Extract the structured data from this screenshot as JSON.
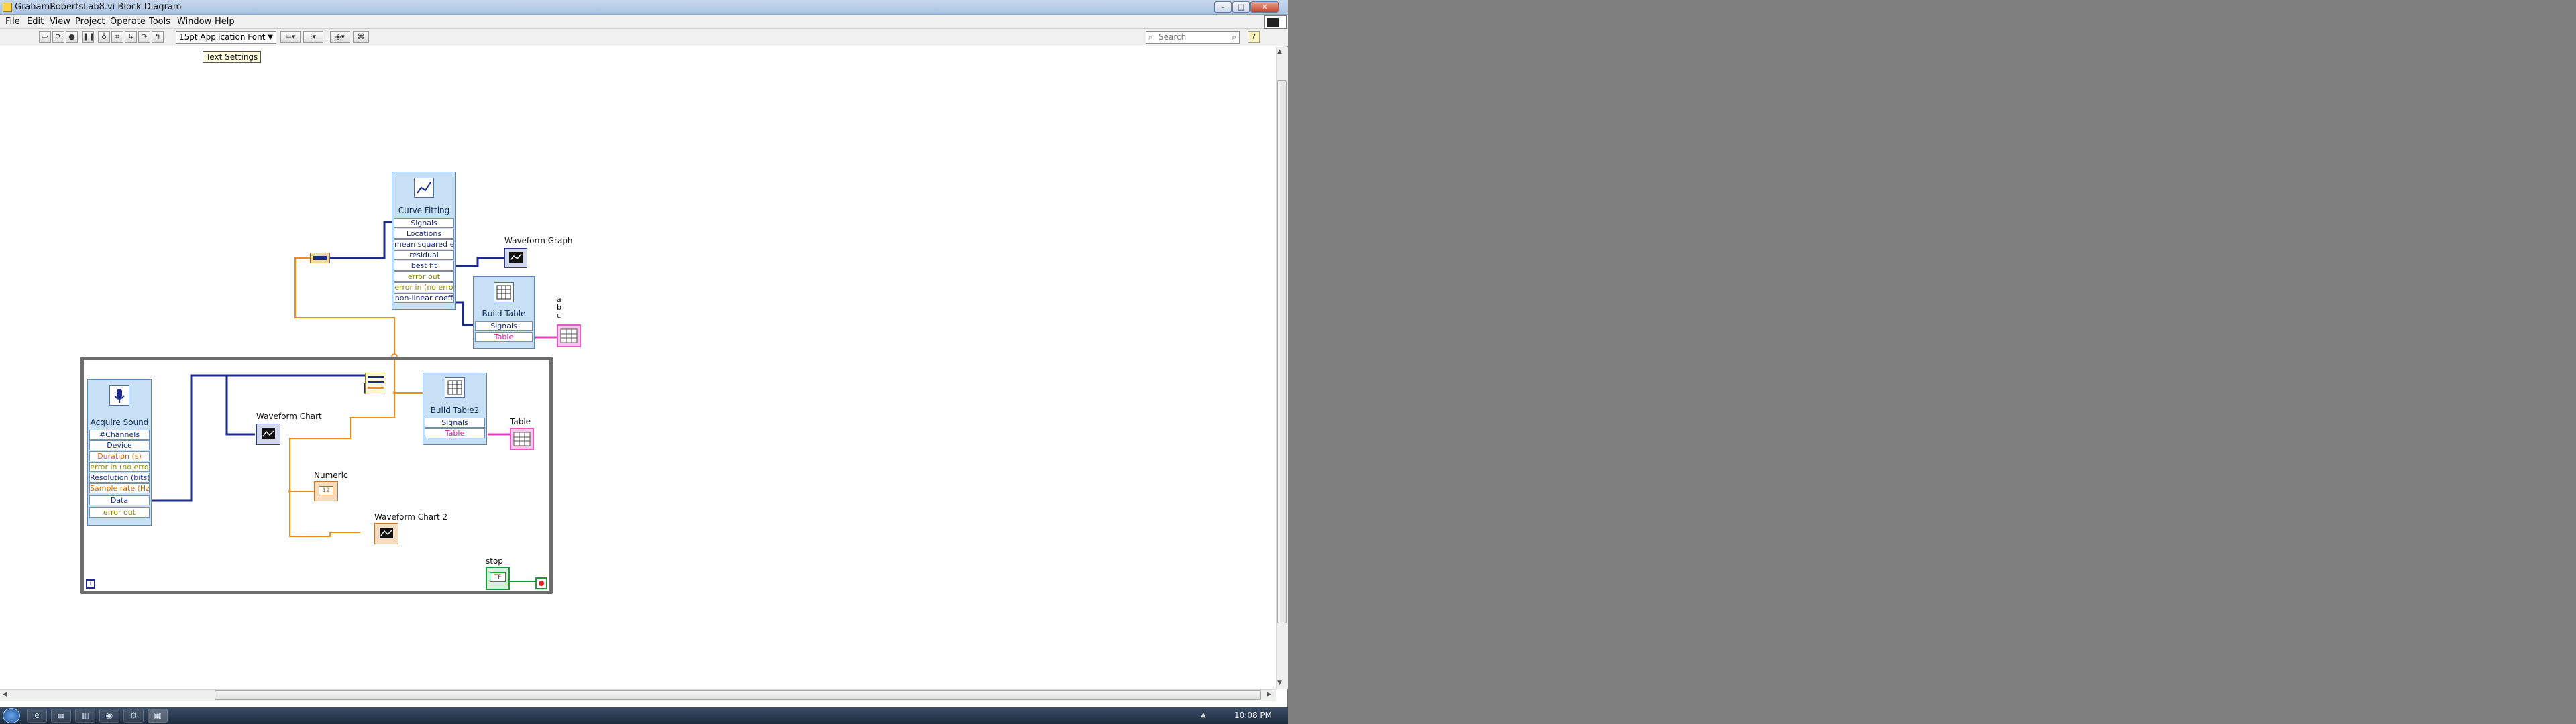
{
  "window": {
    "title": "GrahamRobertsLab8.vi Block Diagram",
    "buttons": [
      "–",
      "□",
      "✕"
    ]
  },
  "menu": [
    "File",
    "Edit",
    "View",
    "Project",
    "Operate",
    "Tools",
    "Window",
    "Help"
  ],
  "toolbar": {
    "font": "15pt Application Font",
    "search_placeholder": "Search",
    "help_glyph": "?"
  },
  "tooltip": "Text Settings",
  "diagram": {
    "curve_fitting": {
      "title": "Curve Fitting",
      "terminals": [
        "Signals",
        "Locations",
        "mean squared e",
        "residual",
        "best fit",
        "error out",
        "error in (no erro",
        "non-linear coeff"
      ]
    },
    "build_table": {
      "title": "Build Table",
      "terminals": [
        "Signals",
        "Table"
      ]
    },
    "build_table2": {
      "title": "Build Table2",
      "terminals": [
        "Signals",
        "Table"
      ]
    },
    "acquire_sound": {
      "title": "Acquire Sound",
      "terminals": [
        "#Channels",
        "Device",
        "Duration (s)",
        "error in (no erro",
        "Resolution (bits)",
        "Sample rate (Hz)",
        "Data",
        "error out"
      ]
    },
    "labels": {
      "waveform_graph": "Waveform Graph",
      "waveform_chart": "Waveform Chart",
      "waveform_chart_2": "Waveform Chart 2",
      "numeric": "Numeric",
      "table": "Table",
      "stop": "stop",
      "coeff_a": "a",
      "coeff_b": "b",
      "coeff_c": "c",
      "loop_index": "i",
      "stop_value": "TF"
    }
  },
  "taskbar": {
    "apps": [
      "e",
      "▤",
      "▥",
      "◉",
      "⚙",
      "▦"
    ],
    "clock": "10:08 PM"
  },
  "colors": {
    "node_fill": "#c8e0f6",
    "wire_blue": "#1b2a8c",
    "wire_orange": "#f08c1e",
    "wire_pink": "#e040c0",
    "loop_border": "#6d6d6d"
  }
}
